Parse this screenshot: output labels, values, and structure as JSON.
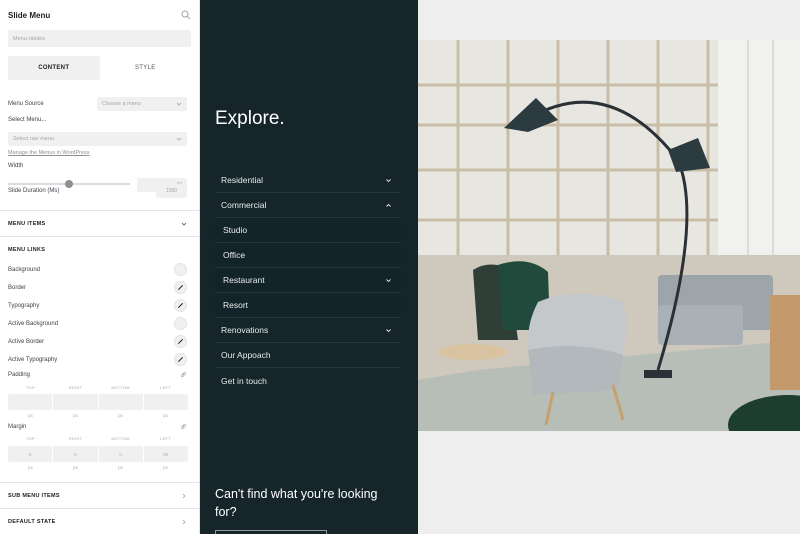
{
  "panel": {
    "title": "Slide Menu",
    "name_placeholder": "Menu-rákdov",
    "tabs": [
      {
        "label": "CONTENT",
        "active": true
      },
      {
        "label": "STYLE",
        "active": false
      }
    ],
    "menu_source": {
      "label": "Menu Source",
      "value": "Choose a menu"
    },
    "select_menu": {
      "label": "Select Menu...",
      "value": "Select nav menu"
    },
    "manage_link": "Manage the Menus in WordPress",
    "width": {
      "label": "Width",
      "value": "37",
      "level": 0.5
    },
    "slide_duration": {
      "label": "Slide Duration (Ms)",
      "value": "1000"
    },
    "sections": {
      "menu_items": "MENU ITEMS",
      "menu_links": "MENU LINKS",
      "sub_menu_items": "SUB MENU ITEMS",
      "default_state": "DEFAULT STATE"
    },
    "link_props": [
      "Background",
      "Border",
      "Typography",
      "Active Background",
      "Active Border",
      "Active Typography"
    ],
    "padding": {
      "label": "Padding",
      "sides": [
        "TOP",
        "RIGHT",
        "BOTTOM",
        "LEFT"
      ],
      "units": [
        "px",
        "px",
        "px",
        "px"
      ]
    },
    "margin": {
      "label": "Margin",
      "sides": [
        "TOP",
        "RIGHT",
        "BOTTOM",
        "LEFT"
      ],
      "values": [
        "0",
        "0",
        "0",
        "50"
      ],
      "units": [
        "px",
        "px",
        "px",
        "px"
      ]
    }
  },
  "menu": {
    "title": "Explore.",
    "items": [
      {
        "label": "Residential",
        "level": 0,
        "arrow": "down"
      },
      {
        "label": "Commercial",
        "level": 0,
        "arrow": "up"
      },
      {
        "label": "Studio",
        "level": 1,
        "arrow": "none"
      },
      {
        "label": "Office",
        "level": 1,
        "arrow": "none"
      },
      {
        "label": "Restaurant",
        "level": 1,
        "arrow": "down"
      },
      {
        "label": "Resort",
        "level": 1,
        "arrow": "none"
      },
      {
        "label": "Renovations",
        "level": 0,
        "arrow": "down"
      },
      {
        "label": "Our Appoach",
        "level": 0,
        "arrow": "none"
      },
      {
        "label": "Get in touch",
        "level": 0,
        "arrow": "none"
      }
    ],
    "cta": "Can't find what you're looking for?"
  },
  "colors": {
    "menu_bg": "#152529",
    "panel_bg": "#ffffff",
    "input_bg": "#f0f0f1"
  }
}
